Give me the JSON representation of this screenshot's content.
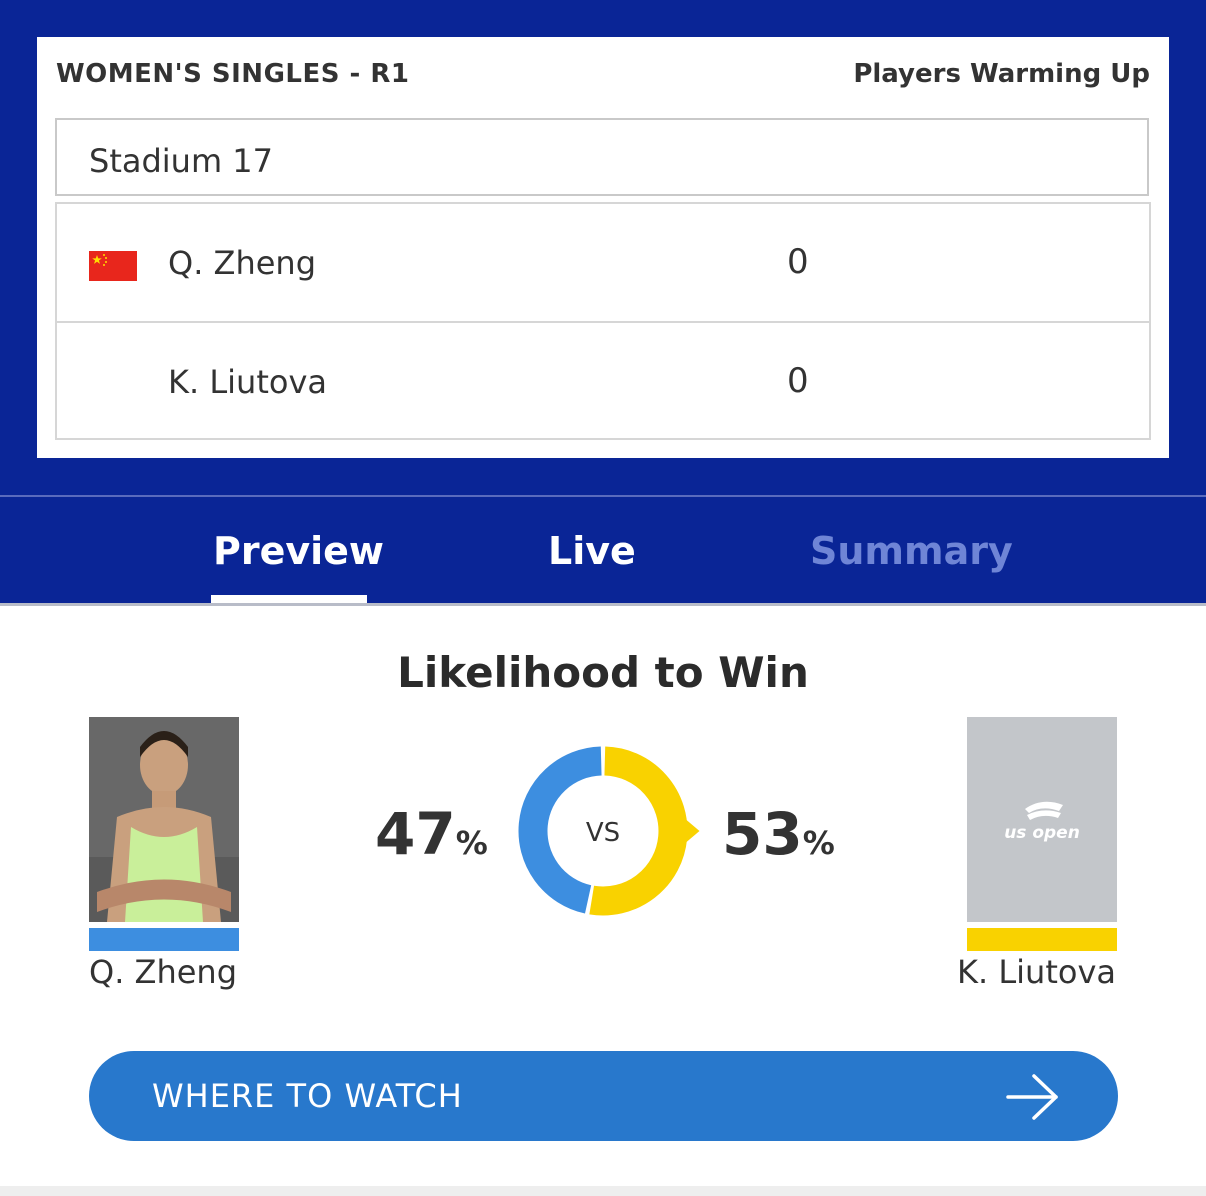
{
  "scorecard": {
    "event_title": "WOMEN'S SINGLES - R1",
    "status": "Players Warming Up",
    "court": "Stadium 17",
    "players": [
      {
        "name": "Q. Zheng",
        "score": "0",
        "flag": "china-flag-icon"
      },
      {
        "name": "K. Liutova",
        "score": "0"
      }
    ]
  },
  "tabs": [
    {
      "label": "Preview",
      "active": true
    },
    {
      "label": "Live"
    },
    {
      "label": "Summary",
      "disabled": true
    }
  ],
  "prediction": {
    "title": "Likelihood to Win",
    "vs_label": "VS",
    "percent_symbol": "%",
    "left": {
      "name": "Q. Zheng",
      "percent": 47,
      "color": "#3d8ee0",
      "photo": "player-photo"
    },
    "right": {
      "name": "K. Liutova",
      "percent": 53,
      "color": "#f9d200",
      "logo_text": "us open"
    }
  },
  "watch": {
    "label": "WHERE TO WATCH",
    "icon": "arrow-right-icon"
  },
  "colors": {
    "header_blue": "#0a2596",
    "button_blue": "#2878cc",
    "tab_inactive": "#6f85d6"
  }
}
